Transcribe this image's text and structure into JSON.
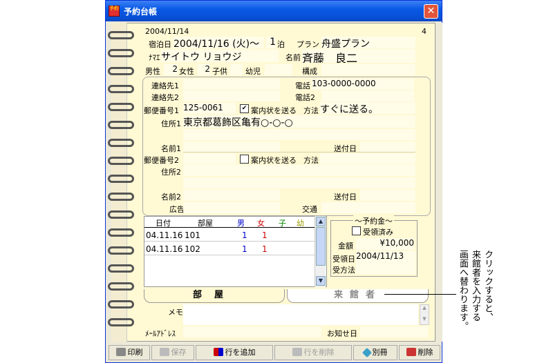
{
  "window": {
    "title": "予約台帳",
    "close": "✕",
    "app_icon": "予約"
  },
  "header": {
    "date": "2004/11/14",
    "page": "4"
  },
  "reservation": {
    "stay_label": "宿泊日",
    "stay_date": "2004/11/16 (火)～",
    "nights": "1",
    "nights_unit": "泊",
    "plan_label": "プラン",
    "plan_value": "舟盛プラン",
    "kana_label": "ﾅﾏｴ",
    "kana_value": "サイトウ リョウジ",
    "name_label": "名前",
    "name_value": "斉藤　良二",
    "male_label": "男性",
    "male_value": "2",
    "female_label": "女性",
    "female_value": "2",
    "child_label": "子供",
    "infant_label": "幼児",
    "composition_label": "構成"
  },
  "contact": {
    "contact1_label": "連絡先1",
    "contact2_label": "連絡先2",
    "phone_label": "電話",
    "phone_value": "103-0000-0000",
    "phone2_label": "電話2"
  },
  "address1": {
    "postal_label": "郵便番号1",
    "postal_value": "125-0061",
    "guide_label": "案内状を送る",
    "guide_checked": "✔",
    "method_label": "方法",
    "method_value": "すぐに送る。",
    "address_label": "住所1",
    "address_value": "東京都葛飾区亀有○-○-○",
    "name_label": "名前1",
    "sent_label": "送付日"
  },
  "address2": {
    "postal_label": "郵便番号2",
    "guide_label": "案内状を送る",
    "method_label": "方法",
    "address_label": "住所2",
    "name_label": "名前2",
    "sent_label": "送付日"
  },
  "misc": {
    "ad_label": "広告",
    "transport_label": "交通"
  },
  "rooms_table": {
    "headers": {
      "date": "日付",
      "room": "部屋",
      "male": "男",
      "female": "女",
      "child": "子",
      "infant": "幼"
    },
    "rows": [
      {
        "date": "04.11.16",
        "room": "101",
        "male": "1",
        "female": "1"
      },
      {
        "date": "04.11.16",
        "room": "102",
        "male": "1",
        "female": "1"
      }
    ]
  },
  "payment": {
    "title": "～予約金～",
    "received_label": "受領済み",
    "amount_label": "金額",
    "amount_value": "¥10,000",
    "received_date_label": "受領日",
    "received_date_value": "2004/11/13",
    "method_label": "受方法"
  },
  "tabs": {
    "rooms": "部屋",
    "visitors": "来館者"
  },
  "notes": {
    "memo_label": "メモ",
    "email_label": "ﾒｰﾙｱﾄﾞﾚｽ",
    "notify_label": "お知せ日"
  },
  "toolbar": {
    "print": "印刷",
    "save": "保存",
    "add_row": "行を追加",
    "delete_row": "行を削除",
    "other": "別冊",
    "delete": "削除"
  },
  "annotation": {
    "line1": "クリックすると、",
    "line2": "来館者を入力する",
    "line3": "画面へ替わります。"
  },
  "colors": {
    "male": "#0000cc",
    "female": "#cc0000",
    "child": "#008800",
    "infant": "#999900"
  }
}
